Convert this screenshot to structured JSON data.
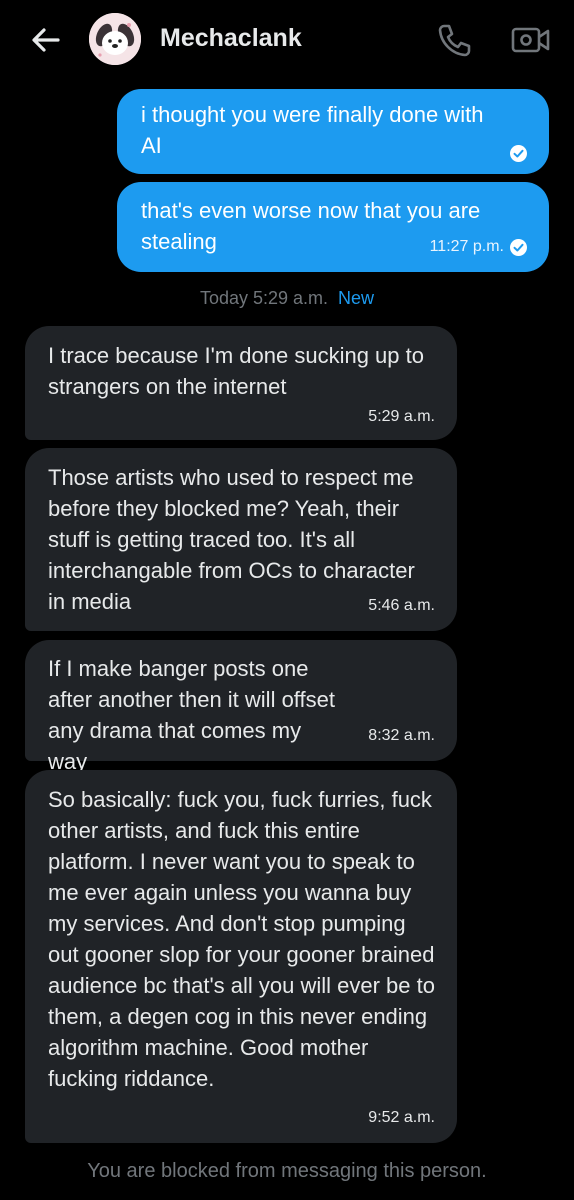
{
  "header": {
    "contact_name": "Mechaclank",
    "back_icon": "arrow-left-icon",
    "call_icon": "phone-icon",
    "video_icon": "video-camera-icon"
  },
  "messages_sent": [
    {
      "text": "i thought you were finally done with AI",
      "time": "",
      "status": "read"
    },
    {
      "text": "that's even worse now that you are stealing",
      "time": "11:27 p.m.",
      "status": "read"
    }
  ],
  "divider": {
    "label": "Today 5:29 a.m.",
    "new_label": "New"
  },
  "messages_received": [
    {
      "text": "I trace because I'm done sucking up to strangers on the internet",
      "time": "5:29 a.m."
    },
    {
      "text": "Those artists who used to respect me before they blocked me? Yeah, their stuff is getting traced too. It's all interchangable from OCs to character in media",
      "time": "5:46 a.m."
    },
    {
      "text": "If I make banger posts one after another then it will offset any drama that comes my way",
      "time": "8:32 a.m."
    },
    {
      "text": "So basically: fuck you, fuck furries, fuck other artists, and fuck this entire platform. I never want you to speak to me ever again unless you wanna buy my services. And don't stop pumping out gooner slop for your gooner brained audience bc that's all you will ever be to them, a degen cog in this never ending algorithm machine. Good mother fucking riddance.",
      "time": "9:52 a.m."
    }
  ],
  "footer": {
    "blocked_notice": "You are blocked from messaging this person."
  },
  "colors": {
    "accent": "#1d9bf0",
    "bubble_received": "#202327",
    "background": "#000000",
    "muted": "#71767b"
  }
}
